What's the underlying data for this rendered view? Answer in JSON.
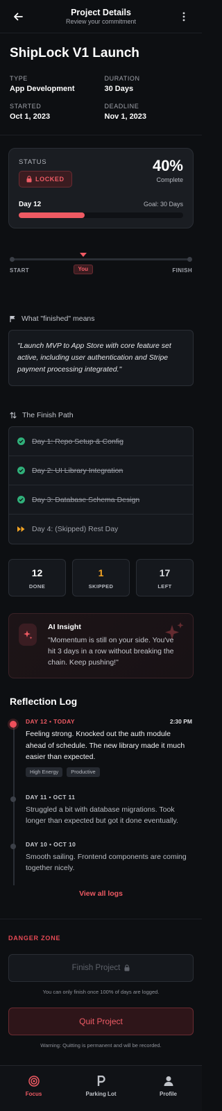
{
  "header": {
    "title": "Project Details",
    "subtitle": "Review your commitment"
  },
  "project": {
    "title": "ShipLock V1 Launch",
    "meta": [
      {
        "label": "TYPE",
        "value": "App Development"
      },
      {
        "label": "DURATION",
        "value": "30 Days"
      },
      {
        "label": "STARTED",
        "value": "Oct 1, 2023"
      },
      {
        "label": "DEADLINE",
        "value": "Nov 1, 2023"
      }
    ]
  },
  "status": {
    "label": "STATUS",
    "badge": "LOCKED",
    "percent_text": "40%",
    "percent_label": "Complete",
    "day_text": "Day 12",
    "goal_text": "Goal: 30 Days",
    "progress": 0.4
  },
  "timeline": {
    "start_label": "START",
    "finish_label": "FINISH",
    "you_label": "You",
    "position": 0.4
  },
  "finished": {
    "heading": "What \"finished\" means",
    "quote": "\"Launch MVP to App Store with core feature set active, including user authentication and Stripe payment processing integrated.\""
  },
  "finish_path": {
    "heading": "The Finish Path",
    "items": [
      {
        "label": "Day 1: Repo Setup & Config",
        "state": "done"
      },
      {
        "label": "Day 2: UI Library Integration",
        "state": "done"
      },
      {
        "label": "Day 3: Database Schema Design",
        "state": "done"
      },
      {
        "label": "Day 4: (Skipped) Rest Day",
        "state": "skipped"
      }
    ]
  },
  "stats": [
    {
      "value": "12",
      "label": "DONE",
      "color": "#ffffff"
    },
    {
      "value": "1",
      "label": "SKIPPED",
      "color": "#f5a524"
    },
    {
      "value": "17",
      "label": "LEFT",
      "color": "#d8dade"
    }
  ],
  "insight": {
    "title": "AI Insight",
    "text": "\"Momentum is still on your side. You've hit 3 days in a row without breaking the chain. Keep pushing!\""
  },
  "reflection": {
    "title": "Reflection Log",
    "entries": [
      {
        "head": "DAY 12 • TODAY",
        "time": "2:30 PM",
        "text": "Feeling strong. Knocked out the auth module ahead of schedule. The new library made it much easier than expected.",
        "tags": [
          "High Energy",
          "Productive"
        ]
      },
      {
        "head": "DAY 11 • OCT 11",
        "text": "Struggled a bit with database migrations. Took longer than expected but got it done eventually."
      },
      {
        "head": "DAY 10 • OCT 10",
        "text": "Smooth sailing. Frontend components are coming together nicely."
      }
    ],
    "view_all": "View all logs"
  },
  "danger": {
    "label": "DANGER ZONE",
    "finish_button": "Finish Project",
    "finish_hint": "You can only finish once 100% of days are logged.",
    "quit_button": "Quit Project",
    "quit_hint": "Warning: Quitting is permanent and will be recorded."
  },
  "nav": [
    {
      "label": "Focus",
      "icon": "target-icon",
      "active": true
    },
    {
      "label": "Parking Lot",
      "icon": "parking-icon",
      "active": false
    },
    {
      "label": "Profile",
      "icon": "user-icon",
      "active": false
    }
  ],
  "colors": {
    "accent": "#ef5a63",
    "success": "#30b07a",
    "warning": "#f5a524",
    "background": "#0d0f12"
  }
}
